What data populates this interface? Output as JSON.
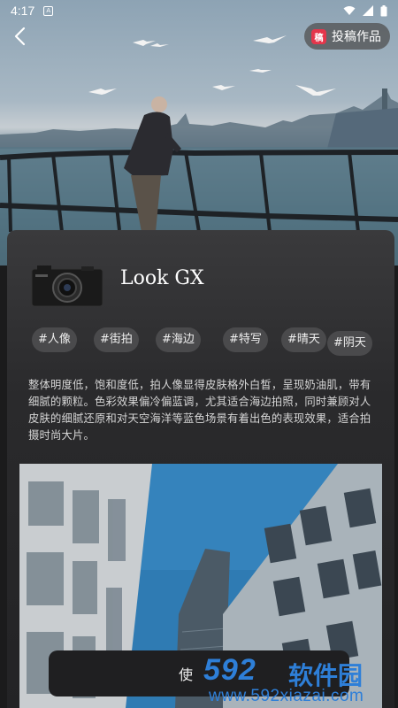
{
  "status_bar": {
    "time": "4:17",
    "notification_glyph": "A"
  },
  "header": {
    "submit_label": "投稿作品",
    "submit_badge": "稿"
  },
  "filter": {
    "title": "Look GX",
    "tags": [
      "#人像",
      "#街拍",
      "#海边",
      "#特写",
      "#晴天",
      "#阴天"
    ],
    "description": "整体明度低，饱和度低，拍人像显得皮肤格外白皙，呈现奶油肌，带有细腻的颗粒。色彩效果偏冷偏蓝调，尤其适合海边拍照，同时兼顾对人皮肤的细腻还原和对天空海洋等蓝色场景有着出色的表现效果，适合拍摄时尚大片。"
  },
  "action_bar": {
    "use_label": "使"
  },
  "watermark": {
    "logo": "592",
    "name": "软件园",
    "url": "www.592xiazai.com"
  },
  "icons": [
    "back-arrow-icon",
    "wifi-icon",
    "signal-icon",
    "battery-icon",
    "notification-icon",
    "camera-icon"
  ],
  "colors": {
    "accent_badge": "#e5364b",
    "watermark_blue": "#2e7fd8",
    "card_bg": "#2a2a2c",
    "tag_bg": "#4a4a4c"
  }
}
